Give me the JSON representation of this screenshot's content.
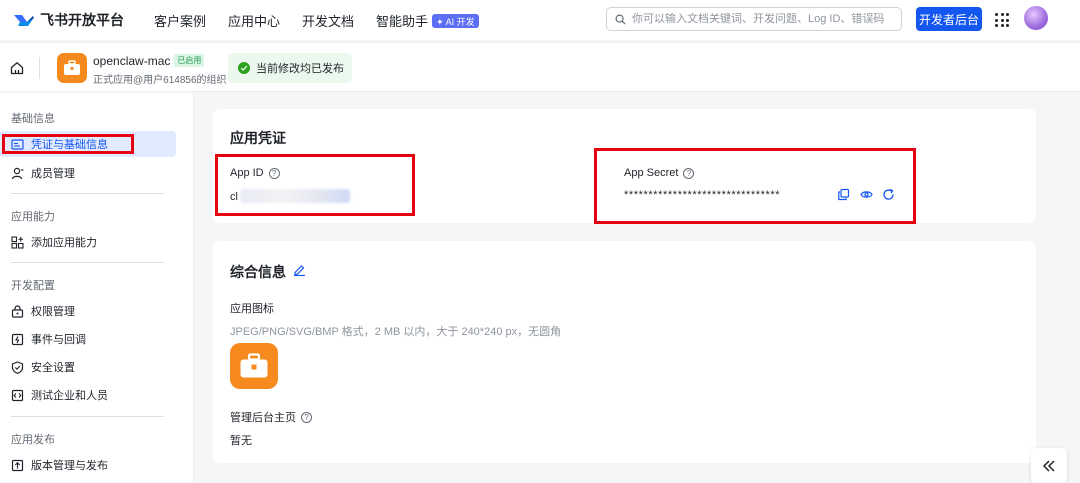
{
  "topnav": {
    "logo_title": "飞书开放平台",
    "items": [
      "客户案例",
      "应用中心",
      "开发文档",
      "智能助手"
    ],
    "ai_badge": "✦ AI 开发",
    "search_placeholder": "你可以输入文档关键词、开发问题、Log ID、错误码",
    "dev_console_label": "开发者后台"
  },
  "app": {
    "name": "openclaw-mac",
    "status": "已启用",
    "subtitle": "正式应用@用户614856的组织",
    "publish_tip": "当前修改均已发布"
  },
  "sidebar": {
    "groups": [
      {
        "title": "基础信息",
        "items": [
          "凭证与基础信息",
          "成员管理"
        ]
      },
      {
        "title": "应用能力",
        "items": [
          "添加应用能力"
        ]
      },
      {
        "title": "开发配置",
        "items": [
          "权限管理",
          "事件与回调",
          "安全设置",
          "测试企业和人员"
        ]
      },
      {
        "title": "应用发布",
        "items": [
          "版本管理与发布"
        ]
      }
    ]
  },
  "credentials": {
    "title": "应用凭证",
    "app_id_label": "App ID",
    "app_id_prefix": "cl",
    "app_secret_label": "App Secret",
    "app_secret_value": "********************************"
  },
  "general": {
    "title": "综合信息",
    "icon_label": "应用图标",
    "icon_desc": "JPEG/PNG/SVG/BMP 格式，2 MB 以内，大于 240*240 px，无圆角",
    "homepage_label": "管理后台主页",
    "homepage_value": "暂无"
  },
  "colors": {
    "brand_blue": "#1456f0",
    "app_orange": "#f78a1e",
    "highlight_red": "#e60012",
    "success_green": "#2ea121"
  }
}
